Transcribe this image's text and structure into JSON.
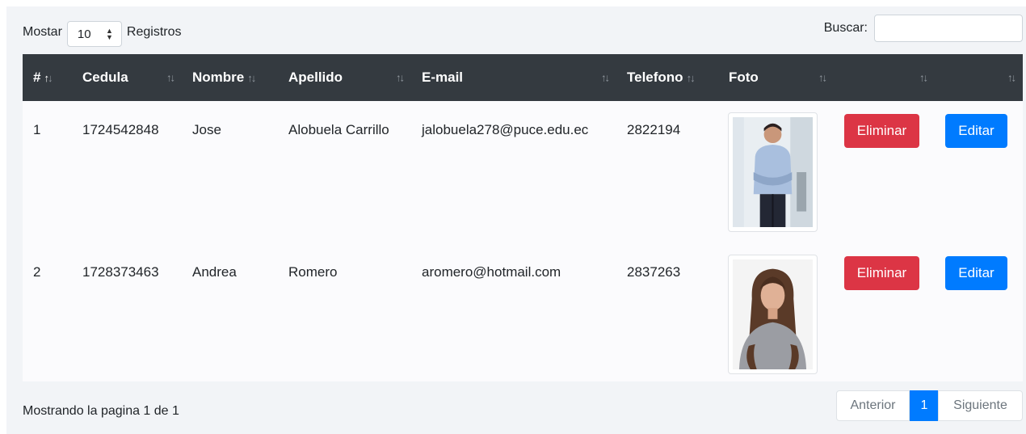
{
  "length_control": {
    "prefix": "Mostar",
    "value": "10",
    "suffix": "Registros"
  },
  "search": {
    "label": "Buscar:",
    "value": ""
  },
  "table": {
    "headers": [
      "#",
      "Cedula",
      "Nombre",
      "Apellido",
      "E-mail",
      "Telefono",
      "Foto",
      "",
      ""
    ],
    "rows": [
      {
        "id": "1",
        "cedula": "1724542848",
        "nombre": "Jose",
        "apellido": "Alobuela Carrillo",
        "email": "jalobuela278@puce.edu.ec",
        "telefono": "2822194",
        "delete_label": "Eliminar",
        "edit_label": "Editar"
      },
      {
        "id": "2",
        "cedula": "1728373463",
        "nombre": "Andrea",
        "apellido": "Romero",
        "email": "aromero@hotmail.com",
        "telefono": "2837263",
        "delete_label": "Eliminar",
        "edit_label": "Editar"
      }
    ]
  },
  "footer": {
    "info": "Mostrando la pagina 1 de 1"
  },
  "pagination": {
    "prev": "Anterior",
    "current": "1",
    "next": "Siguiente"
  },
  "colors": {
    "header_bg": "#343a40",
    "danger": "#dc3545",
    "primary": "#007bff"
  }
}
